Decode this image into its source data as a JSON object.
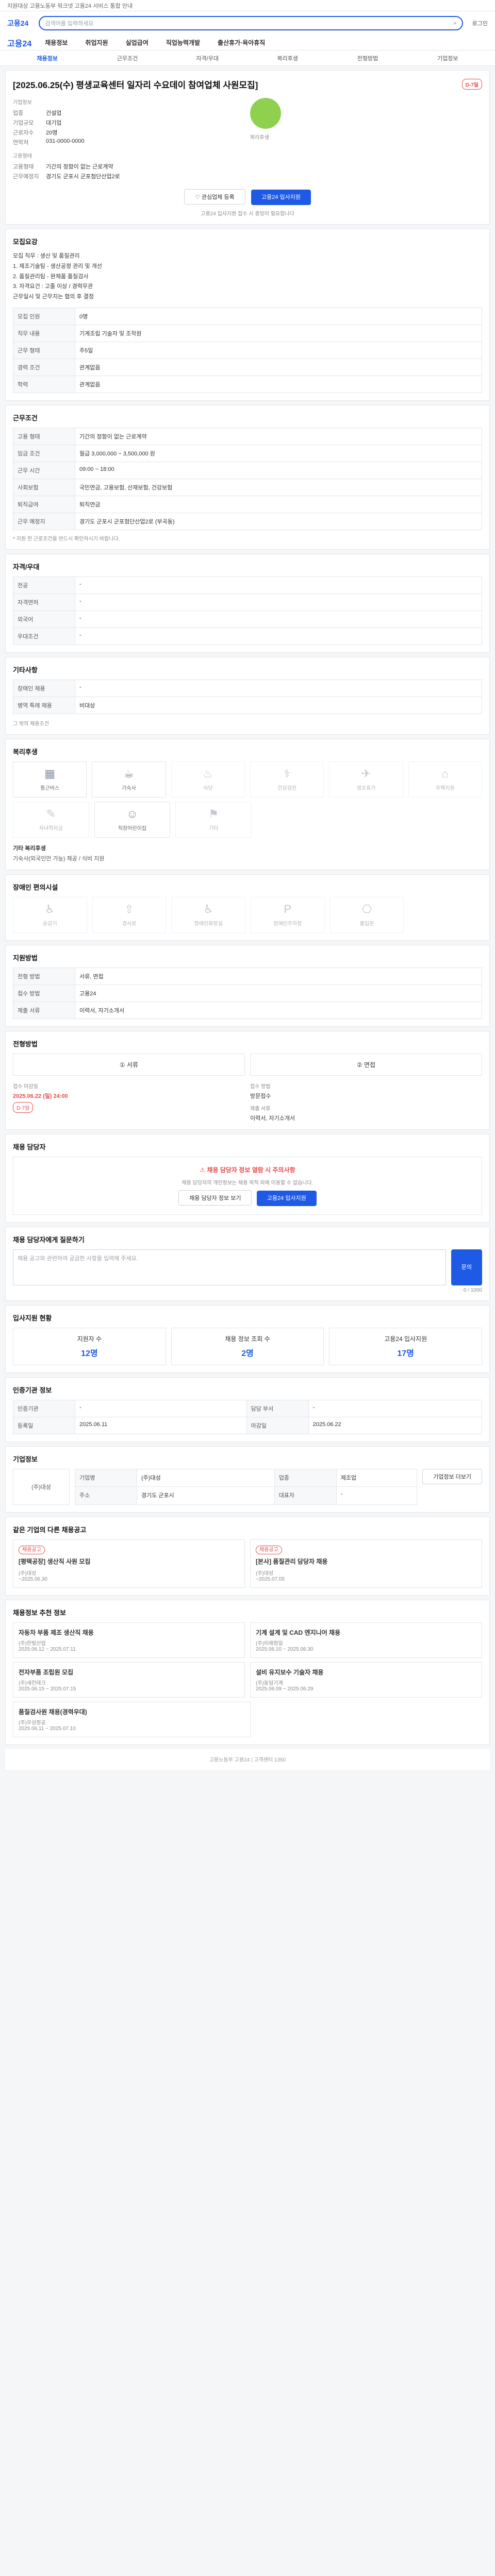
{
  "topbar": {
    "notice": "지원대상 고용노동부 워크넷 고용24 서비스 통합 안내"
  },
  "header": {
    "search_placeholder": "검색어를 입력하세요",
    "login": "로그인"
  },
  "gnb": {
    "logo": "고용24",
    "items": [
      "채용정보",
      "취업지원",
      "실업급여",
      "직업능력개발",
      "출산휴가·육아휴직"
    ]
  },
  "tabs": [
    "채용정보",
    "근무조건",
    "자격/우대",
    "복리후생",
    "전형방법",
    "기업정보"
  ],
  "job": {
    "title": "[2025.06.25(수) 평생교육센터 일자리 수요데이 참여업체 사원모집]",
    "status": "D-7일",
    "company_label": "기업정보",
    "rows": [
      {
        "k": "업종",
        "v": "건설업"
      },
      {
        "k": "기업규모",
        "v": "대기업"
      },
      {
        "k": "근로자수",
        "v": "20명"
      },
      {
        "k": "연락처",
        "v": "031-0000-0000"
      }
    ],
    "cond_label": "고용형태",
    "cond_rows": [
      {
        "k": "고용형태",
        "v": "기간의 정함이 없는 근로계약"
      },
      {
        "k": "근무예정지",
        "v": "경기도 군포시 군포첨단산업2로"
      }
    ],
    "welfare_label": "복리후생",
    "btn_scrap": "관심업체 등록",
    "btn_apply": "고용24 입사지원",
    "apply_note": "고용24 입사지원 접수 시 증빙이 필요합니다"
  },
  "recruit": {
    "title": "모집요강",
    "content_lines": [
      "모집 직무 : 생산 및 품질관리",
      "1. 제조기술팀 - 생산공정 관리 및 개선",
      "2. 품질관리팀 - 완제품 품질검사",
      "3. 자격요건 : 고졸 이상 / 경력무관",
      "근무일시 및 근무지는 협의 후 결정"
    ],
    "rows": [
      {
        "k": "모집 인원",
        "v": "0명"
      },
      {
        "k": "직무 내용",
        "v": "기계조립 기술자 및 조작원"
      },
      {
        "k": "근무 형태",
        "v": "주5일"
      },
      {
        "k": "경력 조건",
        "v": "관계없음"
      },
      {
        "k": "학력",
        "v": "관계없음"
      }
    ]
  },
  "workcond": {
    "title": "근무조건",
    "rows": [
      {
        "k": "고용 형태",
        "v": "기간의 정함이 없는 근로계약"
      },
      {
        "k": "임금 조건",
        "v": "월급 3,000,000 ~ 3,500,000 원"
      },
      {
        "k": "근무 시간",
        "v": "09:00 ~ 18:00"
      },
      {
        "k": "사회보험",
        "v": "국민연금, 고용보험, 산재보험, 건강보험"
      },
      {
        "k": "퇴직급여",
        "v": "퇴직연금"
      },
      {
        "k": "근무 예정지",
        "v": "경기도 군포시 군포첨단산업2로 (부곡동)"
      }
    ],
    "note": "* 지원 전 근로조건을 반드시 확인하시기 바랍니다."
  },
  "qualify": {
    "title": "자격/우대",
    "rows": [
      {
        "k": "전공",
        "v": "-"
      },
      {
        "k": "자격면허",
        "v": "-"
      },
      {
        "k": "외국어",
        "v": "-"
      },
      {
        "k": "우대조건",
        "v": "-"
      }
    ]
  },
  "other": {
    "title": "기타사항",
    "rows": [
      {
        "k": "장애인 채용",
        "v": "-"
      },
      {
        "k": "병역 특례 채용",
        "v": "비대상"
      }
    ],
    "detail": "그 밖의 채용조건"
  },
  "welfare": {
    "title": "복리후생",
    "items": [
      {
        "icon": "▦",
        "label": "통근버스",
        "on": true
      },
      {
        "icon": "☕",
        "label": "기숙사",
        "on": true
      },
      {
        "icon": "♨",
        "label": "식당",
        "on": false
      },
      {
        "icon": "⚕",
        "label": "건강검진",
        "on": false
      },
      {
        "icon": "✈",
        "label": "경조휴가",
        "on": false
      },
      {
        "icon": "⌂",
        "label": "주택지원",
        "on": false
      }
    ],
    "items2": [
      {
        "icon": "✎",
        "label": "자녀학자금",
        "on": false
      },
      {
        "icon": "☺",
        "label": "직장어린이집",
        "on": true
      },
      {
        "icon": "⚑",
        "label": "기타",
        "on": false
      }
    ],
    "memo_title": "기타 복리후생",
    "memo": "기숙사(외국인만 가능) 제공 / 식비 지원"
  },
  "welfare2": {
    "title": "장애인 편의시설",
    "items": [
      {
        "icon": "♿",
        "label": "승강기",
        "on": false
      },
      {
        "icon": "⇧",
        "label": "경사로",
        "on": false
      },
      {
        "icon": "♿",
        "label": "장애인화장실",
        "on": false
      },
      {
        "icon": "P",
        "label": "장애인주차장",
        "on": false
      },
      {
        "icon": "⎔",
        "label": "출입문",
        "on": false
      }
    ]
  },
  "apply": {
    "title": "지원방법",
    "rows": [
      {
        "k": "전형 방법",
        "v": "서류, 면접"
      },
      {
        "k": "접수 방법",
        "v": "고용24"
      },
      {
        "k": "제출 서류",
        "v": "이력서, 자기소개서"
      }
    ]
  },
  "process": {
    "title": "전형방법",
    "steps": [
      "서류",
      "면접"
    ],
    "deadline_label": "접수 마감일",
    "deadline": "2025.06.22 (일) 24:00",
    "dday": "D-7일",
    "method_label": "접수 방법",
    "method": "방문접수",
    "submit_label": "제출 서류",
    "submit": "이력서, 자기소개서"
  },
  "contact": {
    "title": "채용 담당자",
    "notice": "채용 담당자 정보 열람 시 주의사항",
    "desc": "채용 담당자의 개인정보는 채용 목적 외에 이용할 수 없습니다.",
    "btn1": "채용 담당자 정보 보기",
    "btn2": "고용24 입사지원"
  },
  "inquiry": {
    "title": "채용 담당자에게 질문하기",
    "placeholder": "채용 공고와 관련하여 궁금한 사항을 입력해 주세요.",
    "counter": "0 / 1000",
    "submit": "문의"
  },
  "stats": {
    "title": "입사지원 현황",
    "items": [
      {
        "label": "지원자 수",
        "value": "12명"
      },
      {
        "label": "채용 정보 조회 수",
        "value": "2명"
      },
      {
        "label": "고용24 입사지원",
        "value": "17명"
      }
    ]
  },
  "manager": {
    "title": "인증기관 정보",
    "rows": [
      {
        "k": "인증기관",
        "v": "-"
      },
      {
        "k": "담당 부서",
        "v": "-"
      },
      {
        "k": "등록일",
        "v": "2025.06.11"
      },
      {
        "k": "마감일",
        "v": "2025.06.22"
      }
    ]
  },
  "company": {
    "title": "기업정보",
    "name": "(주)대성",
    "rows": [
      {
        "k": "기업명",
        "v": "(주)대성"
      },
      {
        "k": "업종",
        "v": "제조업"
      },
      {
        "k": "주소",
        "v": "경기도 군포시"
      },
      {
        "k": "대표자",
        "v": "-"
      }
    ],
    "btn": "기업정보 더보기"
  },
  "similar": {
    "title": "같은 기업의 다른 채용공고",
    "items": [
      {
        "badge": "채용공고",
        "name": "[평택공장] 생산직 사원 모집",
        "company": "(주)대성",
        "date": "~2025.06.30"
      },
      {
        "badge": "채용공고",
        "name": "[본사] 품질관리 담당자 채용",
        "company": "(주)대성",
        "date": "~2025.07.05"
      }
    ]
  },
  "recommend": {
    "title": "채용정보 추천 정보",
    "items": [
      {
        "name": "자동차 부품 제조 생산직 채용",
        "company": "(주)한빛산업",
        "date": "2025.06.12 ~ 2025.07.11"
      },
      {
        "name": "기계 설계 및 CAD 엔지니어 채용",
        "company": "(주)미래정밀",
        "date": "2025.06.10 ~ 2025.06.30"
      },
      {
        "name": "전자부품 조립원 모집",
        "company": "(주)세진테크",
        "date": "2025.06.15 ~ 2025.07.15"
      },
      {
        "name": "설비 유지보수 기술자 채용",
        "company": "(주)동일기계",
        "date": "2025.06.09 ~ 2025.06.29"
      },
      {
        "name": "품질검사원 채용(경력우대)",
        "company": "(주)우성정공",
        "date": "2025.06.11 ~ 2025.07.10"
      }
    ]
  },
  "footer": {
    "text": "고용노동부 고용24 | 고객센터 1350"
  }
}
